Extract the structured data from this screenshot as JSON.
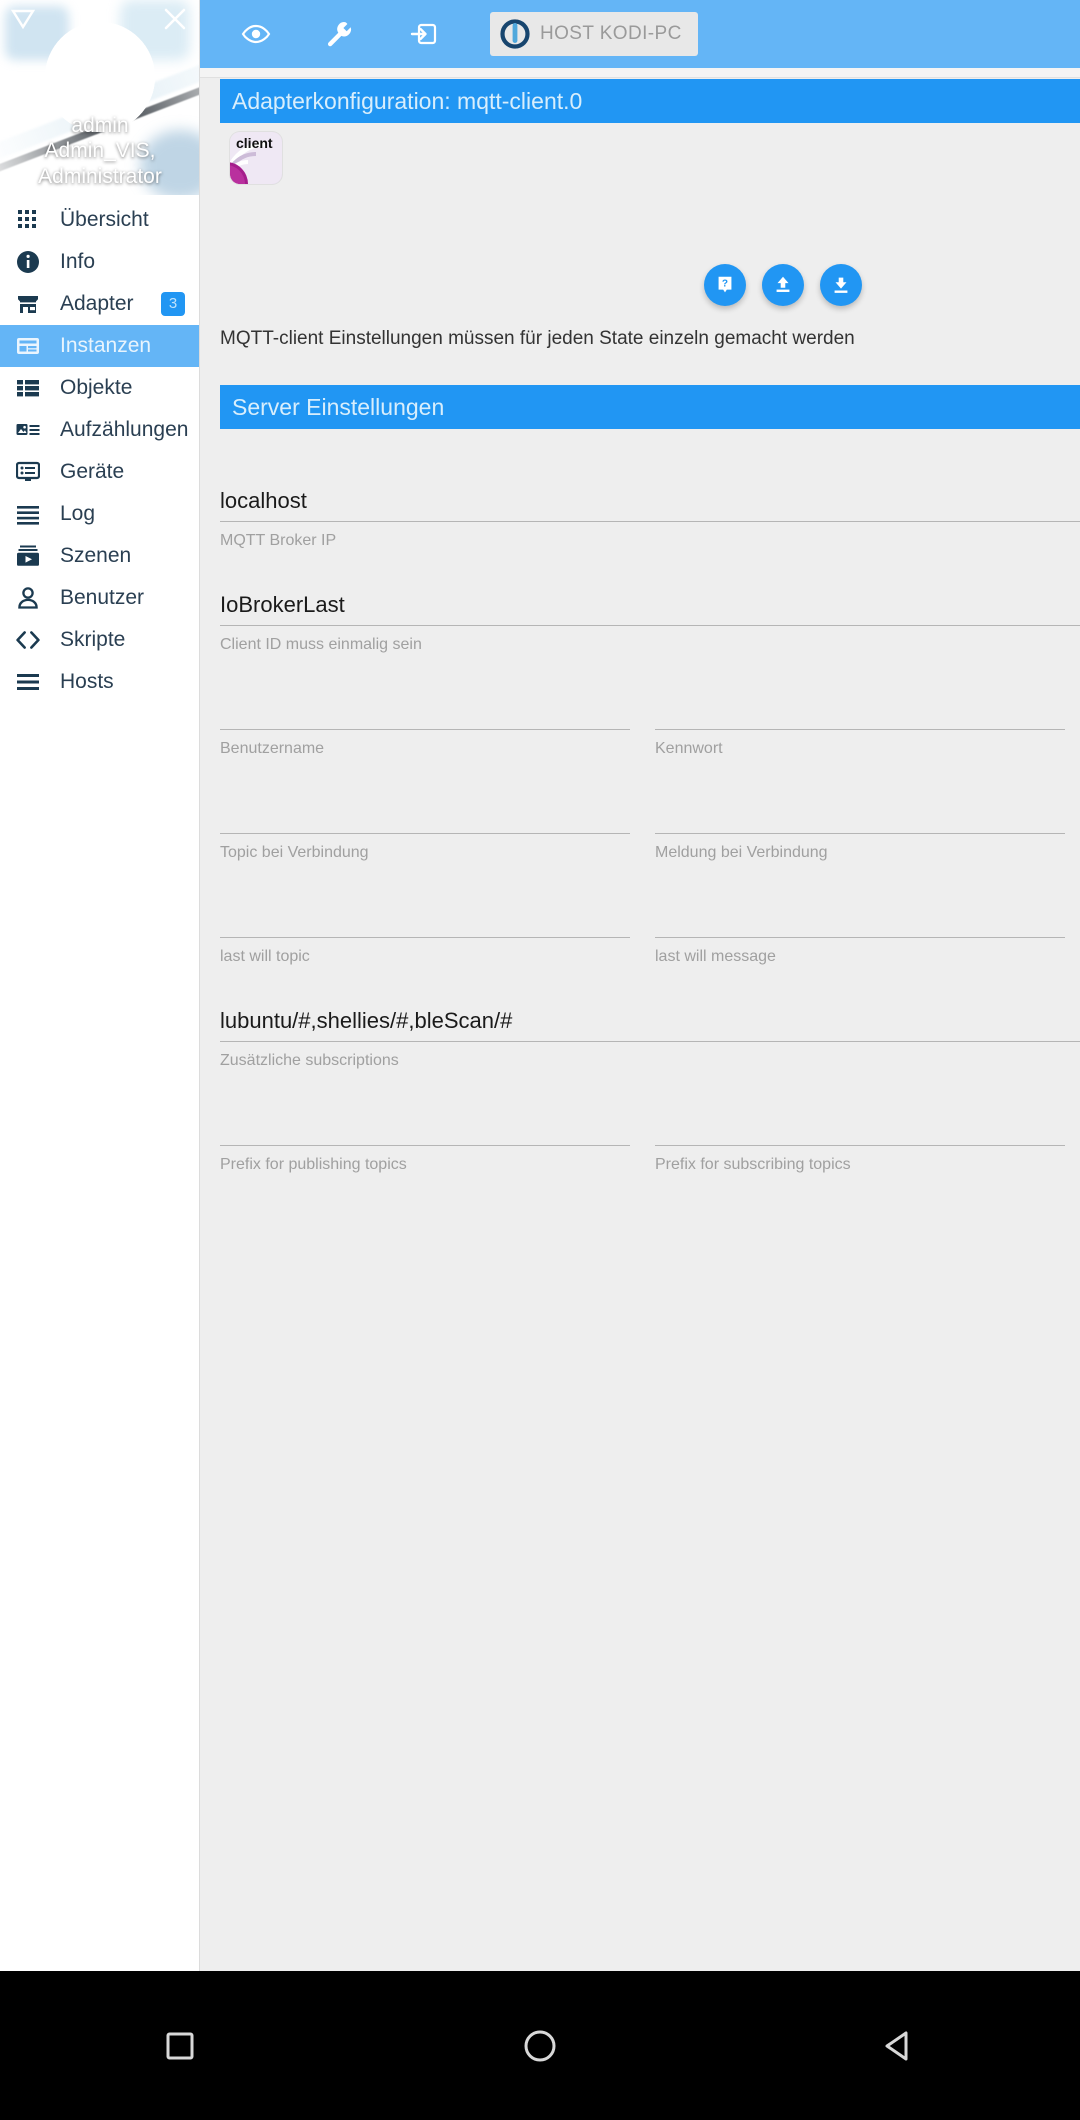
{
  "sidebar": {
    "collapse_icon": "collapse-triangle-icon",
    "close_icon": "close-icon",
    "user": {
      "name": "admin",
      "roles": "Admin_VIS,\nAdministrator",
      "roles_line1": "Admin_VIS,",
      "roles_line2": "Administrator",
      "avatar_icon": "user-avatar-icon"
    },
    "items": [
      {
        "label": "Übersicht",
        "icon": "grid-apps-icon",
        "selected": false,
        "badge": ""
      },
      {
        "label": "Info",
        "icon": "info-circle-icon",
        "selected": false,
        "badge": ""
      },
      {
        "label": "Adapter",
        "icon": "store-front-icon",
        "selected": false,
        "badge": "3"
      },
      {
        "label": "Instanzen",
        "icon": "instance-card-icon",
        "selected": true,
        "badge": ""
      },
      {
        "label": "Objekte",
        "icon": "list-table-icon",
        "selected": false,
        "badge": ""
      },
      {
        "label": "Aufzählungen",
        "icon": "image-list-icon",
        "selected": false,
        "badge": ""
      },
      {
        "label": "Geräte",
        "icon": "device-monitor-icon",
        "selected": false,
        "badge": ""
      },
      {
        "label": "Log",
        "icon": "hamburger-lines-icon",
        "selected": false,
        "badge": ""
      },
      {
        "label": "Szenen",
        "icon": "play-scene-icon",
        "selected": false,
        "badge": ""
      },
      {
        "label": "Benutzer",
        "icon": "person-icon",
        "selected": false,
        "badge": ""
      },
      {
        "label": "Skripte",
        "icon": "code-brackets-icon",
        "selected": false,
        "badge": ""
      },
      {
        "label": "Hosts",
        "icon": "hosts-lines-icon",
        "selected": false,
        "badge": ""
      }
    ]
  },
  "toolbar": {
    "buttons": [
      {
        "icon": "eye-icon",
        "name": "expert-mode-button"
      },
      {
        "icon": "wrench-icon",
        "name": "settings-button"
      },
      {
        "icon": "login-arrow-icon",
        "name": "logout-button"
      }
    ],
    "host_chip": {
      "label": "HOST KODI-PC",
      "logo_icon": "iobroker-logo-icon"
    }
  },
  "main": {
    "config_title": "Adapterkonfiguration: mqtt-client.0",
    "adapter_icon": {
      "name": "mqtt-client-adapter-icon",
      "text": "client"
    },
    "fabs": [
      {
        "icon": "help-question-icon",
        "name": "help-button"
      },
      {
        "icon": "upload-arrow-icon",
        "name": "upload-config-button"
      },
      {
        "icon": "download-arrow-icon",
        "name": "download-config-button"
      }
    ],
    "hint": "MQTT-client Einstellungen müssen für jeden State einzeln gemacht werden",
    "section_header": "Server Einstellungen",
    "fields": [
      {
        "value": "localhost",
        "hint": "MQTT Broker IP",
        "col": "full"
      },
      {
        "value": "IoBrokerLast",
        "hint": "Client ID muss einmalig sein",
        "col": "full"
      },
      {
        "value": "",
        "hint": "Benutzername",
        "col": "left"
      },
      {
        "value": "",
        "hint": "Kennwort",
        "col": "right"
      },
      {
        "value": "",
        "hint": "Topic bei Verbindung",
        "col": "left"
      },
      {
        "value": "",
        "hint": "Meldung bei Verbindung",
        "col": "right"
      },
      {
        "value": "",
        "hint": "last will topic",
        "col": "left"
      },
      {
        "value": "",
        "hint": "last will message",
        "col": "right"
      },
      {
        "value": "lubuntu/#,shellies/#,bleScan/#",
        "hint": "Zusätzliche subscriptions",
        "col": "full"
      },
      {
        "value": "",
        "hint": "Prefix for publishing topics",
        "col": "left"
      },
      {
        "value": "",
        "hint": "Prefix for subscribing topics",
        "col": "right"
      }
    ]
  },
  "navbar": {
    "buttons": [
      {
        "icon": "square-recents-icon",
        "name": "recents-button"
      },
      {
        "icon": "circle-home-icon",
        "name": "home-button"
      },
      {
        "icon": "triangle-back-icon",
        "name": "back-button"
      }
    ]
  },
  "colors": {
    "toolbar_blue": "#64b5f6",
    "accent_blue": "#2196f3",
    "content_bg": "#eeeeee",
    "sidebar_text": "#2a3f52",
    "navbar_bg": "#000000"
  }
}
